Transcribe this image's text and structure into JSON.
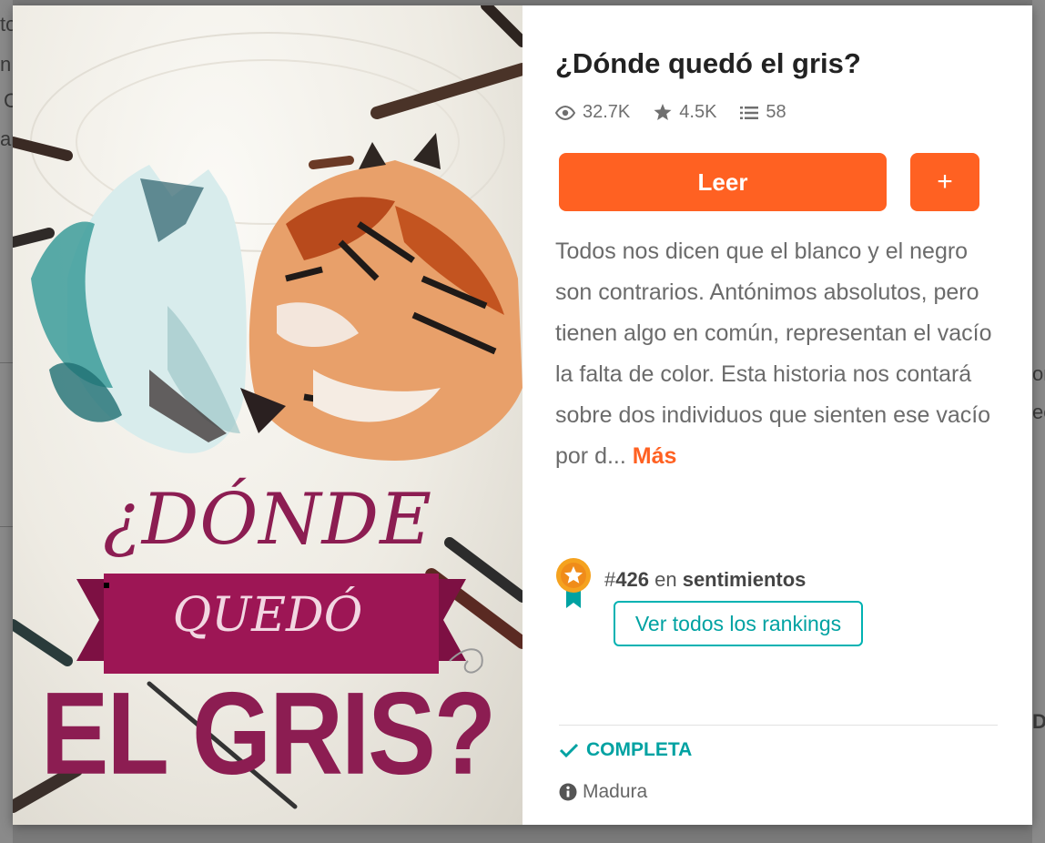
{
  "story": {
    "title": "¿Dónde quedó el gris?",
    "stats": {
      "reads": "32.7K",
      "votes": "4.5K",
      "parts": "58"
    },
    "read_button": "Leer",
    "add_button": "+",
    "description": "Todos nos dicen que el blanco y el negro son contrarios. Antónimos absolutos, pero tienen algo en común, representan el vacío la falta de color. Esta historia nos contará sobre dos individuos que sienten ese vacío por d...",
    "more_link": "Más",
    "ranking": {
      "hash": "#",
      "number": "426",
      "in": "en",
      "category": "sentimientos",
      "button": "Ver todos los rankings"
    },
    "status": "COMPLETA",
    "rating": "Madura"
  },
  "cover": {
    "line1": "¿DÓNDE",
    "line2": "QUEDÓ",
    "line3": "EL GRIS?"
  },
  "background_fragments": [
    "to",
    "n",
    "C",
    "ar",
    "or",
    "ec",
    "D"
  ],
  "colors": {
    "accent": "#ff6122",
    "teal": "#00a2a2",
    "cover_magenta": "#9d1655"
  },
  "icons": {
    "reads": "eye-icon",
    "votes": "star-icon",
    "parts": "list-icon",
    "ranking": "ribbon-badge-icon",
    "status": "check-icon",
    "rating": "info-icon"
  }
}
